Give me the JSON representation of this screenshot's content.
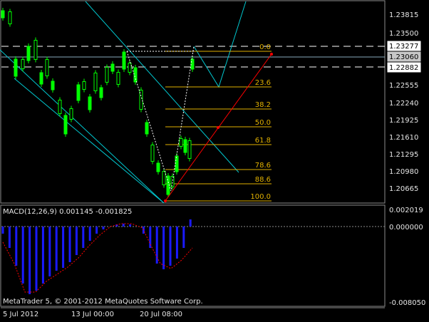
{
  "window": {
    "footer": "MetaTrader 5, © 2001-2012 MetaQuotes Software Corp."
  },
  "price_axis": {
    "labels": [
      "1.23815",
      "1.23500",
      "1.22555",
      "1.22240",
      "1.21925",
      "1.21610",
      "1.21295",
      "1.20980",
      "1.20665"
    ],
    "markers": {
      "upper": "1.23277",
      "current": "1.23060",
      "lower": "1.22882"
    }
  },
  "fibonacci": {
    "levels": [
      "0.0",
      "23.6",
      "38.2",
      "50.0",
      "61.8",
      "78.6",
      "88.6",
      "100.0"
    ]
  },
  "macd": {
    "title": "MACD(12,26,9) 0.001145 -0.001825",
    "axis_labels": [
      "0.002019",
      "0.000000",
      "-0.008050"
    ]
  },
  "time_axis": {
    "labels": [
      "5 Jul 2012",
      "13 Jul 00:00",
      "20 Jul 08:00"
    ]
  },
  "colors": {
    "background": "#000000",
    "candle": "#00ff00",
    "channel": "#00c8d0",
    "fibo": "#e0b000",
    "trend": "#ff0000",
    "macd_hist": "#1a1aff",
    "macd_signal": "#ff0000"
  }
}
